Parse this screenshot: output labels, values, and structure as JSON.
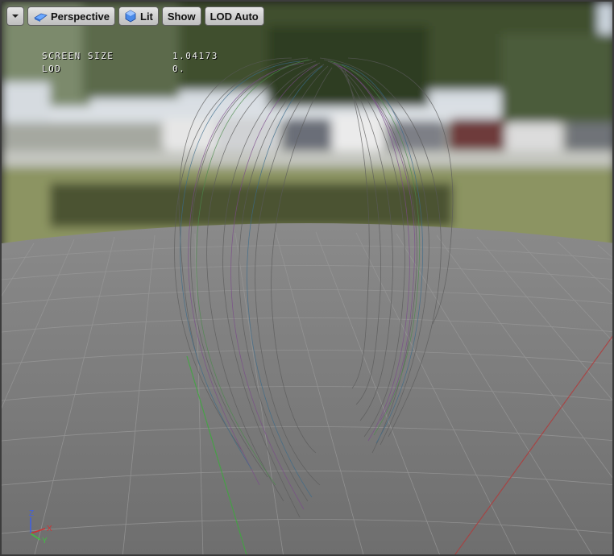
{
  "toolbar": {
    "menu_icon": "chevron-down-icon",
    "perspective_label": "Perspective",
    "perspective_icon": "perspective-cube-icon",
    "lit_label": "Lit",
    "lit_icon": "lit-sphere-icon",
    "show_label": "Show",
    "lod_label": "LOD Auto"
  },
  "stats": {
    "screen_size_label": "SCREEN SIZE",
    "screen_size_value": "1.04173",
    "lod_label": "LOD",
    "lod_value": "0."
  },
  "axis_widget": {
    "z_label": "Z",
    "x_label": "X",
    "y_label": "Y"
  },
  "colors": {
    "sky": "#cfd6de",
    "ground": "#7e7e7e",
    "grass": "#8a9460",
    "axis_x": "#d03030",
    "axis_y": "#40c040",
    "axis_z": "#4060e0"
  }
}
